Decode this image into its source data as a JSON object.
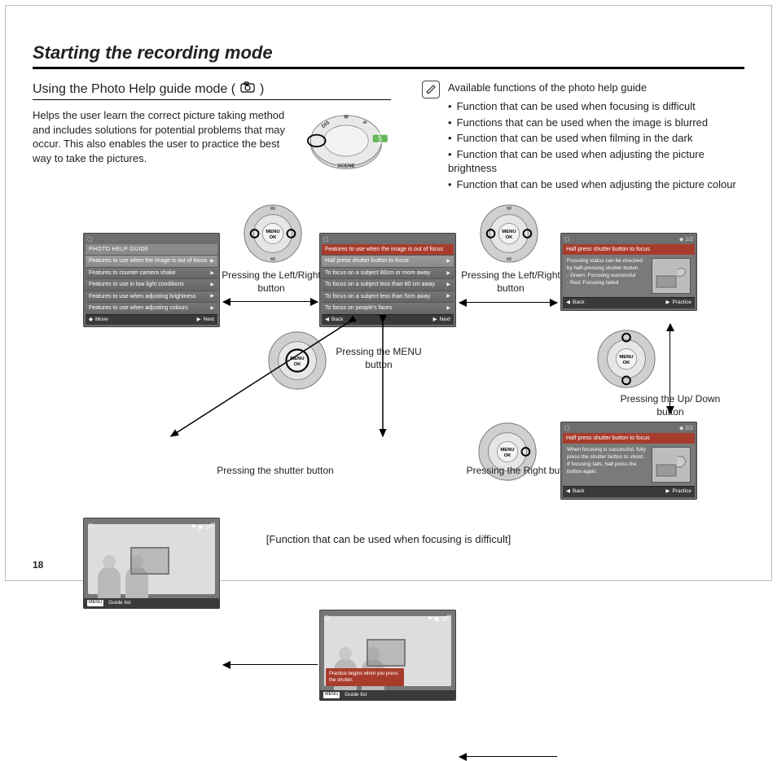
{
  "page": {
    "number": "18",
    "title": "Starting the recording mode",
    "section": "Using the Photo Help guide mode (",
    "section_close": ")",
    "intro": "Helps the user learn the correct picture taking method and includes solutions for potential problems that may occur. This also enables the user to practice the best way to take the pictures.",
    "dial_labels": {
      "auto": "AUTO",
      "p": "P",
      "m": "M",
      "dis": "DIS",
      "scene": "SCENE"
    },
    "note_title": "Available functions of the photo help guide",
    "bullets": [
      "Function that can be used when focusing is difficult",
      "Functions that can be used when the image is blurred",
      "Function that can be used when filming in the dark",
      "Function that can be used when adjusting the picture brightness",
      "Function that can be used when adjusting the picture colour"
    ],
    "caption": "[Function that can be used when focusing is difficult]"
  },
  "labels": {
    "lr": "Pressing the Left/Right  button",
    "menu": "Pressing the MENU button",
    "ud": "Pressing the Up/ Down  button",
    "shutter": "Pressing the shutter button",
    "right": "Pressing the Right button"
  },
  "screens": {
    "a": {
      "title": "PHOTO HELP GUIDE",
      "items": [
        "Features to use when the image is out of focus",
        "Features to counter camera shake",
        "Features to use in low light conditions",
        "Features to use when adjusting brightness",
        "Features to use when adjusting colours"
      ],
      "foot_l": "Move",
      "foot_r": "Next"
    },
    "b": {
      "title": "Features to use when the image is out of focus",
      "items": [
        "Half press shutter button to focus",
        "To focus on a subject 80cm or more away",
        "To focus on a subject less than 80 cm away",
        "To focus on a subject less than 5cm away",
        "To focus on people's faces"
      ],
      "foot_l": "Back",
      "foot_r": "Next"
    },
    "c1": {
      "page": "1/2",
      "title": "Half press shutter button to focus",
      "lines": [
        "Focusing status can be checked",
        "by half-pressing shutter button.",
        "- Green: Focusing successful",
        "- Red: Focusing failed"
      ],
      "foot_l": "Back",
      "foot_r": "Practice"
    },
    "c2": {
      "page": "2/2",
      "title": "Half press shutter button to focus",
      "lines": [
        "When focusing is successful, fully",
        "press the shutter button to shoot.",
        "If focusing fails, half press the",
        "button again."
      ],
      "foot_l": "Back",
      "foot_r": "Practice"
    },
    "d": {
      "popup": "Practice begins when you press the shutter.",
      "foot": "Guide list",
      "menu": "MENU"
    },
    "e": {
      "foot": "Guide list",
      "menu": "MENU"
    }
  }
}
